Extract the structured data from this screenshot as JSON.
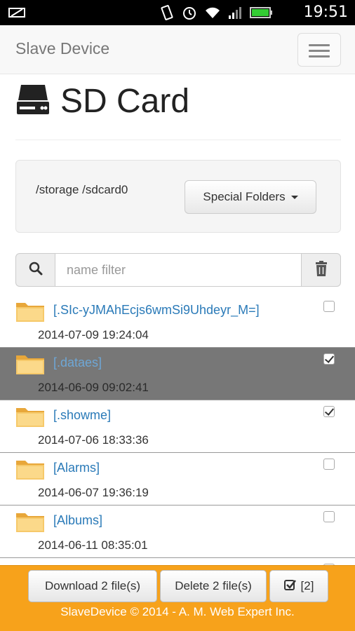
{
  "statusbar": {
    "time": "19:51"
  },
  "navbar": {
    "brand": "Slave Device"
  },
  "page": {
    "title": "SD Card"
  },
  "location": {
    "path": "/storage /sdcard0",
    "special_folders_label": "Special Folders"
  },
  "filter": {
    "placeholder": "name filter",
    "value": ""
  },
  "files": [
    {
      "name": "[.SIc-yJMAhEcjs6wmSi9Uhdeyr_M=]",
      "date": "2014-07-09 19:24:04",
      "checked": false,
      "highlighted": false
    },
    {
      "name": "[.dataes]",
      "date": "2014-06-09 09:02:41",
      "checked": true,
      "highlighted": true
    },
    {
      "name": "[.showme]",
      "date": "2014-07-06 18:33:36",
      "checked": true,
      "highlighted": false
    },
    {
      "name": "[Alarms]",
      "date": "2014-06-07 19:36:19",
      "checked": false,
      "highlighted": false
    },
    {
      "name": "[Albums]",
      "date": "2014-06-11 08:35:01",
      "checked": false,
      "highlighted": false
    }
  ],
  "footer": {
    "download_label": "Download 2 file(s)",
    "delete_label": "Delete 2 file(s)",
    "select_count": "[2]",
    "copyright": "SlaveDevice © 2014 - A. M. Web Expert Inc."
  },
  "colors": {
    "footer_bg": "#f7a21b",
    "link": "#2a7ab8",
    "selected_row": "#777777"
  }
}
